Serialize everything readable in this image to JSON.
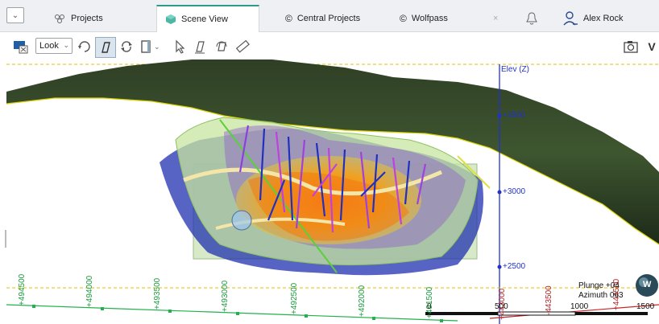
{
  "tabs": [
    {
      "label": "Projects",
      "icon": "projects-icon"
    },
    {
      "label": "Scene View",
      "icon": "scene-cube-icon",
      "active": true
    },
    {
      "label": "Central Projects",
      "icon": "central-icon"
    },
    {
      "label": "Wolfpass",
      "icon": "central-icon"
    }
  ],
  "user": {
    "name": "Alex Rock"
  },
  "toolbar": {
    "look_label": "Look",
    "right_label": "V"
  },
  "scene": {
    "elev_axis_label": "Elev (Z)",
    "elev_ticks": [
      "+3500",
      "+3000",
      "+2500"
    ],
    "x_ticks": [
      "+494500",
      "+494000",
      "+493500",
      "+493000",
      "+492500",
      "+492000",
      "+491500"
    ],
    "y_ticks": [
      "+443000",
      "-443500",
      "+444500"
    ],
    "scale_labels": [
      "0",
      "500",
      "1000",
      "1500"
    ],
    "plunge": "Plunge +04",
    "azimuth": "Azimuth 063",
    "compass_label": "W"
  },
  "colors": {
    "accent": "#2e9a8a",
    "axis_blue": "#2233cc",
    "grid_green": "#22b14c",
    "grid_red": "#cc2222"
  }
}
